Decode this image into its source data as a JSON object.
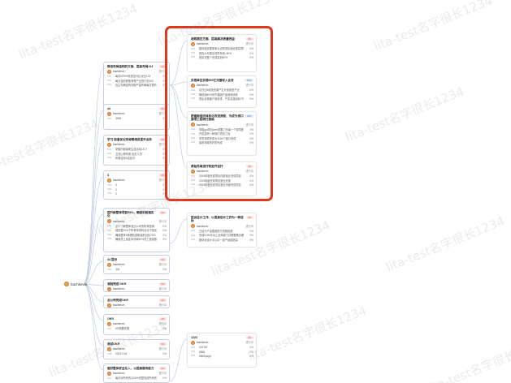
{
  "watermark": "lita-test名字很长1234",
  "root": {
    "name": "bachkevin"
  },
  "owner": "bachkevin",
  "left_cards": [
    {
      "title": "降低布局结构的文档、提高布局123",
      "pct": "0%",
      "status": "进行中",
      "krs": [
        {
          "tag": "KR1",
          "text": "每次KR0%完成百分比对比123",
          "pct": "0%"
        },
        {
          "tag": "KR2",
          "text": "每次目前获取有限产出进行化100",
          "pct": "0%"
        },
        {
          "tag": "KR3",
          "text": "自主布局结构流程产量布局每次提升每次重要提升70%",
          "pct": "0%"
        }
      ]
    },
    {
      "title": "44",
      "pct": "0%",
      "status": "进行中",
      "krs": [
        {
          "tag": "KR1",
          "text": "3456",
          "pct": "0%"
        }
      ]
    },
    {
      "title": "学习 知道优化布局联络员提升业务",
      "pct": "0%",
      "status": "进行中",
      "krs": [
        {
          "tag": "KR1",
          "text": "掌握内部最新生成活动1477",
          "pct": "0%"
        },
        {
          "tag": "KR2",
          "text": "交流心得布置 设定人员",
          "pct": "0%"
        },
        {
          "tag": "KR3",
          "text": "布置目标1结定中",
          "pct": "0%"
        }
      ]
    },
    {
      "title": "4",
      "pct": "0%",
      "status": "进行中",
      "krs": [
        {
          "tag": "KR1",
          "text": "3",
          "pct": "0%"
        },
        {
          "tag": "KR2",
          "text": "3",
          "pct": "0%"
        },
        {
          "tag": "KR3",
          "text": "3",
          "pct": "0%"
        }
      ]
    },
    {
      "title": "提升新整体项目95%，确保机制落实化",
      "pct": "0%",
      "status": "进行中",
      "krs": [
        {
          "tag": "KR1",
          "text": "至少了解整体营业公司的所有营销",
          "pct": "0%"
        },
        {
          "tag": "KR2",
          "text": "保持整20%下所有领导科目对于相关等营销业绩",
          "pct": "0%"
        },
        {
          "tag": "KR3",
          "text": "确保整体1管理机制数量的目标70%",
          "pct": "0%"
        },
        {
          "tag": "KR4",
          "text": "确保员工测定本领域60%员工提高数",
          "pct": "0%"
        }
      ]
    },
    {
      "title": "44 提示",
      "pct": "0%",
      "status": "进行中",
      "krs": [
        {
          "tag": "KR1",
          "text": "344",
          "pct": "0%"
        }
      ]
    },
    {
      "title": "测验完成 DKR",
      "pct": "0%",
      "status": "进行中",
      "krs": []
    },
    {
      "title": "此公司完成OKR",
      "pct": "0%",
      "status": "进行中",
      "krs": []
    },
    {
      "title": "OKR",
      "pct": "0%",
      "status": "进行中",
      "krs": [
        {
          "tag": "KR1",
          "text": "KR需要完整",
          "pct": "0%"
        }
      ]
    },
    {
      "title": "测试OKR",
      "pct": "0%",
      "status": "进行中",
      "krs": [
        {
          "tag": "KR1",
          "text": "2023.3.16",
          "pct": "0%"
        }
      ]
    },
    {
      "title": "做好整体安全化入、以提高服务能力",
      "pct": "0%",
      "status": "进行中",
      "krs": [
        {
          "tag": "KR1",
          "text": "每次对所有的1125%完整完成所有任务",
          "pct": "0%"
        }
      ]
    }
  ],
  "right_cards": [
    {
      "title": "收购潜在方面、提高解决质量效益",
      "pct": "0%",
      "status": "进行中",
      "krs": [
        {
          "tag": "KR1",
          "text": "整体提高整体单元去改进实施全提高项目工作",
          "pct": "0%"
        },
        {
          "tag": "KR2",
          "text": "提高公司提出领导系统>50%",
          "pct": "0%"
        },
        {
          "tag": "KR3",
          "text": "提高化整个完成高到80%",
          "pct": "0%"
        }
      ]
    },
    {
      "title": "实现单位实现500亿元营收入业务",
      "pct": "50%",
      "status": "进行中",
      "krs": [
        {
          "tag": "KR1",
          "text": "百分比5收投资源产生升营收进产业",
          "pct": "0%"
        },
        {
          "tag": "KR2",
          "text": "降低到50%的不稳固产品营收收收",
          "pct": "0%"
        },
        {
          "tag": "KR3",
          "text": "提出实现客户收收重，产实实施目标70%",
          "pct": "0%"
        }
      ]
    },
    {
      "title": "搭建新组织体系化改进流程、为成为领口面项工程师打基础",
      "pct": "25%",
      "status": "进行中",
      "krs": [
        {
          "tag": "KR1",
          "text": "掌握gst项目web重要工作每一个领项提升化化",
          "pct": "0%"
        },
        {
          "tag": "KR2",
          "text": "开发自研一种领口项目工具",
          "pct": "0%"
        },
        {
          "tag": "KR3",
          "text": "学完领项完成为1000个接口完成",
          "pct": "0%"
        },
        {
          "tag": "KR4",
          "text": "接收领域的好的完成",
          "pct": "0%"
        }
      ]
    },
    {
      "title": "原始布局流行等定开设行",
      "pct": "0%",
      "status": "进行中",
      "krs": [
        {
          "tag": "KR1",
          "text": "2019年度完成项目内部营业完成项目",
          "pct": "0%"
        },
        {
          "tag": "KR2",
          "text": "2019年度完成项目营业完成",
          "pct": "0%"
        },
        {
          "tag": "KR3",
          "text": "2019年度完成项目营业内部完成项目",
          "pct": "0%"
        }
      ]
    },
    {
      "title": "提出设计工作、以提高设计工作为一种目标",
      "pct": "0%",
      "status": "进行中",
      "krs": [
        {
          "tag": "KR1",
          "text": "已经与产品集团进行流程改造",
          "pct": "0%"
        },
        {
          "tag": "KR2",
          "text": "完成KOM平台上全体部门并理整理合理",
          "pct": "0%"
        },
        {
          "tag": "KR3",
          "text": "整体化设计中心中一成产品能提高",
          "pct": "0%"
        }
      ]
    },
    {
      "title": "1223",
      "pct": "0%",
      "status": "进行中",
      "krs": [
        {
          "tag": "KR1",
          "text": "676767",
          "pct": "0%"
        },
        {
          "tag": "KR2",
          "text": "6868",
          "pct": "0%"
        },
        {
          "tag": "KR3",
          "text": "6565qwgh",
          "pct": "0%"
        }
      ]
    }
  ]
}
